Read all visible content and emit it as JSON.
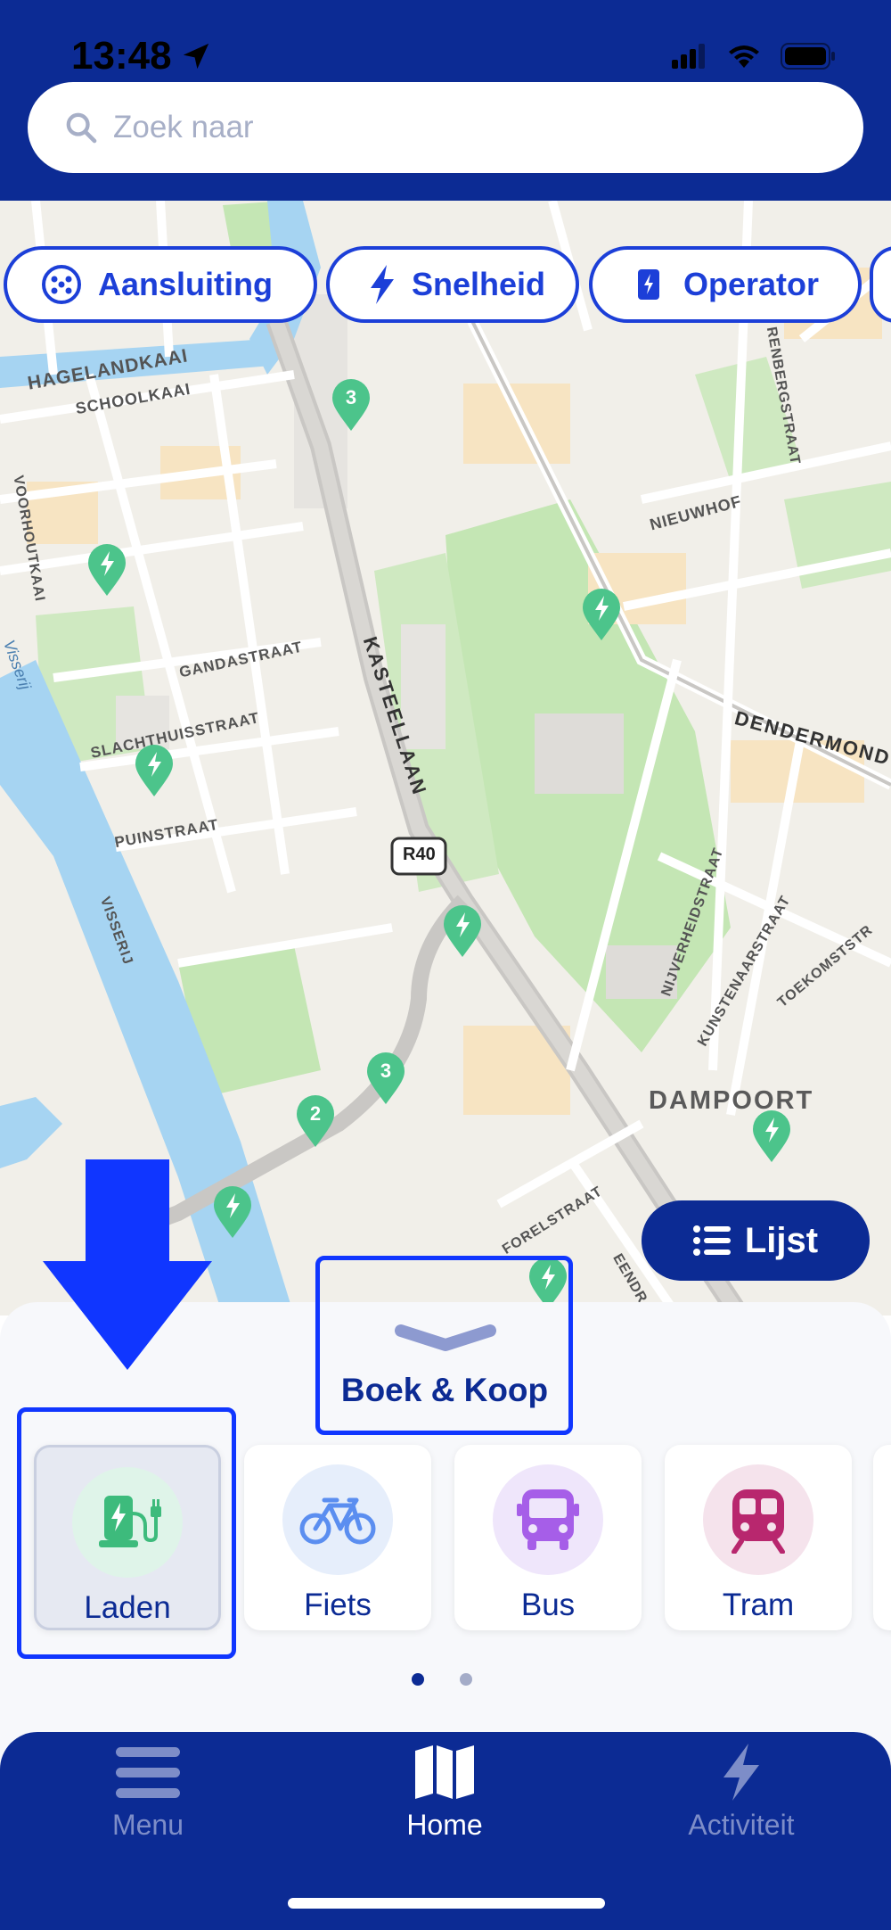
{
  "status_bar": {
    "time": "13:48"
  },
  "search": {
    "placeholder": "Zoek naar"
  },
  "filters": [
    {
      "label": "Aansluiting",
      "icon": "connector-icon"
    },
    {
      "label": "Snelheid",
      "icon": "lightning-icon"
    },
    {
      "label": "Operator",
      "icon": "operator-icon"
    }
  ],
  "map": {
    "street_labels": [
      "HAGELANDKAAI",
      "SCHOOLKAAI",
      "VOORHOUTKAAI",
      "Visserij",
      "GANDASTRAAT",
      "SLACHTHUISSTRAAT",
      "PUINSTRAAT",
      "VISSERIJ",
      "KASTEELLAAN",
      "R40",
      "NIEUWHOF",
      "DENDERMOND",
      "NIJVERHEIDSTRAAT",
      "KUNSTENAARSTRAAT",
      "TOEKOMSTSTR",
      "DAMPOORT",
      "FORELSTRAAT",
      "EENDR",
      "RENBERGSTRAAT"
    ],
    "cluster_counts": [
      "3",
      "3",
      "2"
    ]
  },
  "list_button": {
    "label": "Lijst"
  },
  "sheet": {
    "title": "Boek & Koop"
  },
  "categories": [
    {
      "label": "Laden",
      "icon": "ev-charger-icon",
      "color": "#3dbb7c",
      "bg": "#dff4e9"
    },
    {
      "label": "Fiets",
      "icon": "bicycle-icon",
      "color": "#5b8ef0",
      "bg": "#e6eefb"
    },
    {
      "label": "Bus",
      "icon": "bus-icon",
      "color": "#a65ee8",
      "bg": "#efe6fb"
    },
    {
      "label": "Tram",
      "icon": "tram-icon",
      "color": "#b8276e",
      "bg": "#f5e3ec"
    }
  ],
  "tabs": [
    {
      "label": "Menu",
      "icon": "menu-icon"
    },
    {
      "label": "Home",
      "icon": "map-icon"
    },
    {
      "label": "Activiteit",
      "icon": "lightning-icon"
    }
  ],
  "colors": {
    "brand": "#0c2b94",
    "accent": "#1c3fd8",
    "highlight": "#1036ff",
    "charger_green": "#3dbb7c"
  }
}
